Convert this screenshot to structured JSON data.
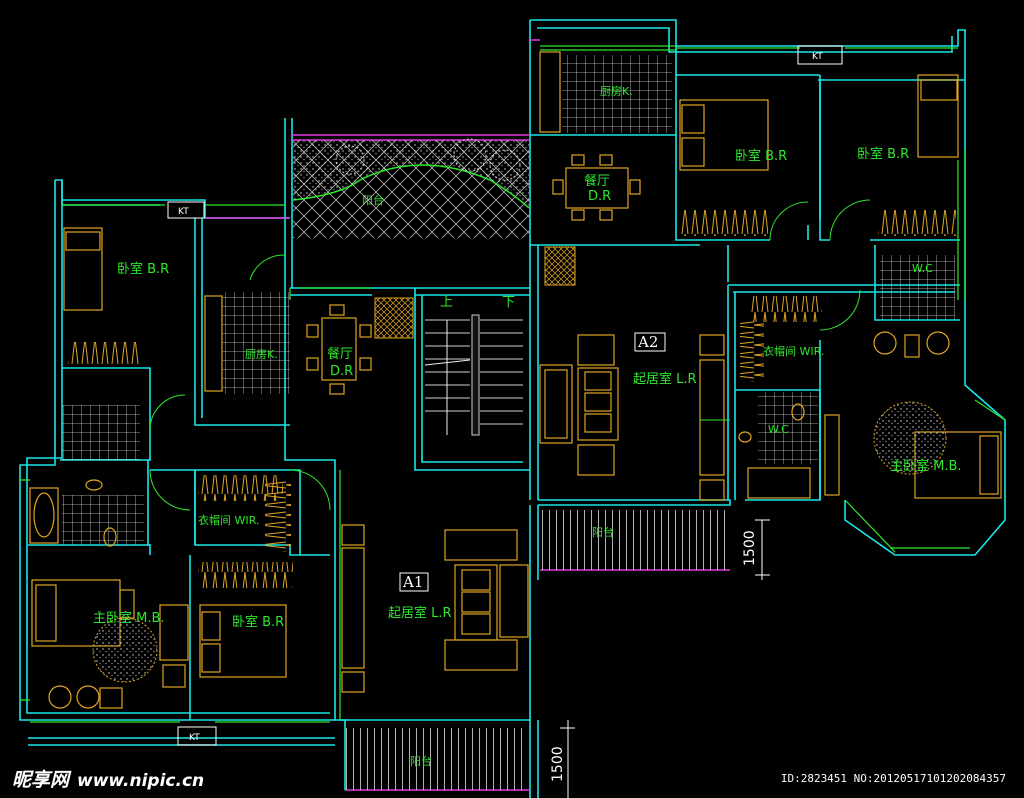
{
  "rooms": {
    "kitchen_top": "厨房K.",
    "dining_top_cn": "餐厅",
    "dining_top_en": "D.R",
    "bedroom_top_mid": "卧室 B.R",
    "bedroom_top_right": "卧室 B.R",
    "bedroom_left": "卧室 B.R",
    "kitchen_left": "厨房K.",
    "dining_left_cn": "餐厅",
    "dining_left_en": "D.R",
    "balcony_top": "阳台",
    "stair_up": "上",
    "stair_down": "下",
    "wir_a2": "衣帽间 WIR.",
    "living_a2": "起居室 L.R",
    "wc_a2": "W.C",
    "master_a2": "主卧室 M.B.",
    "balcony_a2": "阳台",
    "wir_a1": "衣帽间 WIR.",
    "master_a1": "主卧室 M.B.",
    "bedroom_a1": "卧室 B.R",
    "living_a1": "起居室 L.R",
    "balcony_a1": "阳台",
    "wc_right_small": "W.C"
  },
  "tags": {
    "a1": "A1",
    "a2": "A2"
  },
  "dimensions": {
    "upper": "1500",
    "lower": "1500"
  },
  "kt_label": "KT",
  "watermark": {
    "brand": "昵享网",
    "url": "www.nipic.cn"
  },
  "image_id": "ID:2823451 NO:20120517101202084357",
  "colors": {
    "wall": "#19e6e6",
    "room_text": "#2ee82e",
    "furniture": "#e0a521",
    "grid": "#cfcfcf",
    "magenta": "#e23be2"
  }
}
